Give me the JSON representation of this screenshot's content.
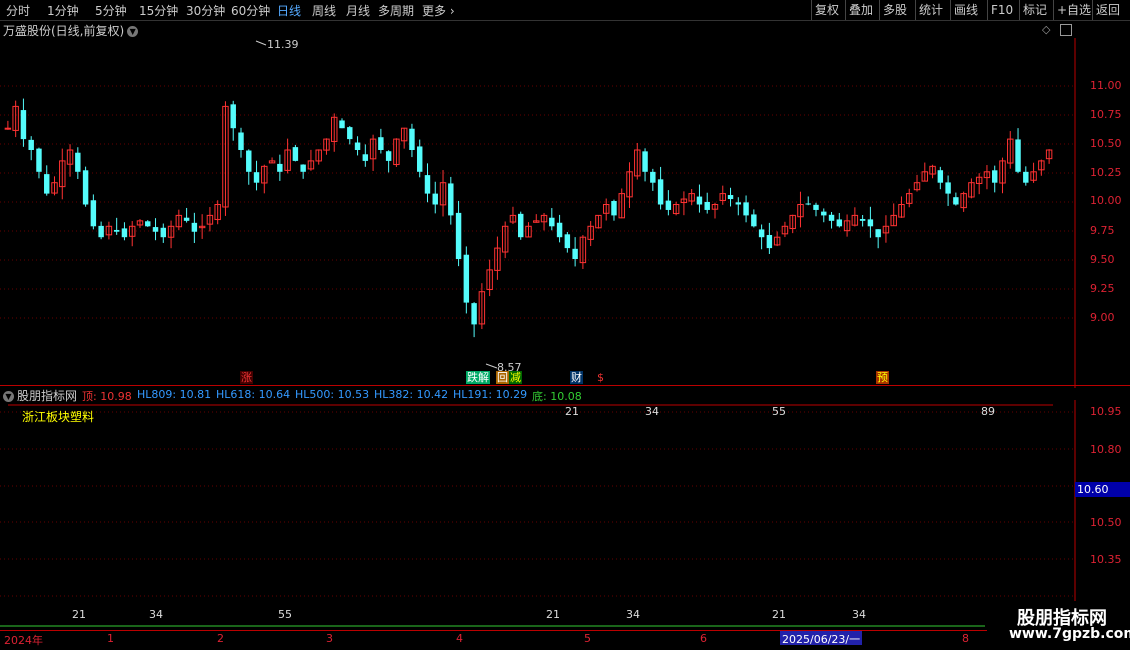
{
  "toolbar": {
    "periods": [
      "分时",
      "1分钟",
      "5分钟",
      "15分钟",
      "30分钟",
      "60分钟",
      "日线",
      "周线",
      "月线",
      "多周期",
      "更多"
    ],
    "active_period": "日线",
    "right_buttons": [
      "复权",
      "叠加",
      "多股",
      "统计",
      "画线",
      "F10",
      "标记",
      "+自选",
      "返回"
    ]
  },
  "main_chart": {
    "title": "万盛股份(日线,前复权)",
    "price_ticks": [
      "11.00",
      "10.75",
      "10.50",
      "10.25",
      "10.00",
      "9.75",
      "9.50",
      "9.25",
      "9.00"
    ],
    "high_marker": "11.39",
    "low_marker": "8.57",
    "signals": [
      {
        "text": "涨",
        "color": "#e33",
        "bg": "#400"
      },
      {
        "text": "跌解",
        "color": "#fff",
        "bg": "#0a6"
      },
      {
        "text": "回",
        "color": "#fff",
        "bg": "#a60"
      },
      {
        "text": "减",
        "color": "#ff0",
        "bg": "#060"
      },
      {
        "text": "财",
        "color": "#fff",
        "bg": "#036"
      },
      {
        "text": "$",
        "color": "#e33",
        "bg": "#000"
      },
      {
        "text": "预",
        "color": "#ff0",
        "bg": "#a30"
      }
    ]
  },
  "indicator": {
    "name": "股朋指标网",
    "values": [
      {
        "label": "顶: 10.98",
        "color": "#e33"
      },
      {
        "label": "HL809: 10.81",
        "color": "#39f"
      },
      {
        "label": "HL618: 10.64",
        "color": "#39f"
      },
      {
        "label": "HL500: 10.53",
        "color": "#39f"
      },
      {
        "label": "HL382: 10.42",
        "color": "#39f"
      },
      {
        "label": "HL191: 10.29",
        "color": "#39f"
      },
      {
        "label": "底: 10.08",
        "color": "#3c3"
      }
    ],
    "sector_text": "浙江板块塑料",
    "fib_top": [
      "21",
      "34",
      "55",
      "89"
    ],
    "fib_bottom": [
      "21",
      "34",
      "55",
      "21",
      "34",
      "21",
      "34"
    ],
    "axis_ticks": [
      "10.95",
      "10.80",
      "10.50",
      "10.35"
    ],
    "current_value": "10.60"
  },
  "date_axis": {
    "labels": [
      "2024年",
      "1",
      "2",
      "3",
      "4",
      "5",
      "6",
      "8"
    ],
    "cursor_date": "2025/06/23/一"
  },
  "watermark": {
    "line1": "股朋指标网",
    "line2": "www.7gpzb.com"
  },
  "colors": {
    "up": "#ff3232",
    "down": "#54fcfc",
    "axis": "#b00",
    "bg": "#000"
  }
}
